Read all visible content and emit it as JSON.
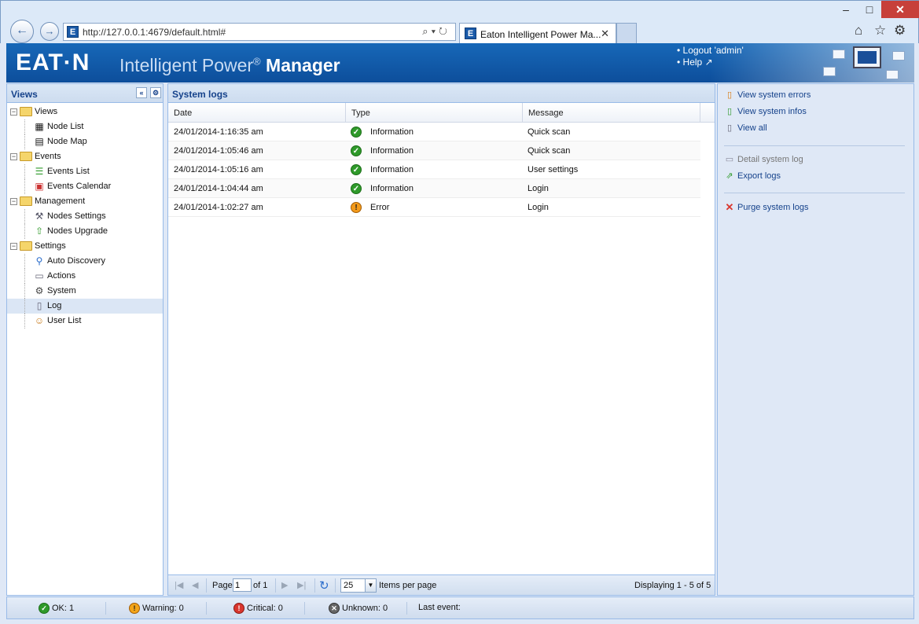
{
  "browser": {
    "url": "http://127.0.0.1:4679/default.html#",
    "tab_title": "Eaton Intelligent Power Ma...",
    "favicon_letter": "E"
  },
  "header": {
    "logo": "EAT·N",
    "title_light": "Intelligent Power",
    "title_reg": "®",
    "title_bold": "Manager",
    "logout": "• Logout 'admin'",
    "help": "• Help"
  },
  "views": {
    "title": "Views",
    "tree": [
      {
        "label": "Views",
        "children": [
          {
            "label": "Node List",
            "icon": "node-list-icon"
          },
          {
            "label": "Node Map",
            "icon": "node-map-icon"
          }
        ]
      },
      {
        "label": "Events",
        "children": [
          {
            "label": "Events List",
            "icon": "events-list-icon"
          },
          {
            "label": "Events Calendar",
            "icon": "calendar-icon"
          }
        ]
      },
      {
        "label": "Management",
        "children": [
          {
            "label": "Nodes Settings",
            "icon": "nodes-settings-icon"
          },
          {
            "label": "Nodes Upgrade",
            "icon": "upgrade-icon"
          }
        ]
      },
      {
        "label": "Settings",
        "children": [
          {
            "label": "Auto Discovery",
            "icon": "discovery-icon"
          },
          {
            "label": "Actions",
            "icon": "actions-icon"
          },
          {
            "label": "System",
            "icon": "system-gear-icon"
          },
          {
            "label": "Log",
            "icon": "log-icon"
          },
          {
            "label": "User List",
            "icon": "users-icon"
          }
        ]
      }
    ]
  },
  "logs": {
    "title": "System logs",
    "columns": [
      "Date",
      "Type",
      "Message"
    ],
    "rows": [
      {
        "date": "24/01/2014-1:16:35 am",
        "type": "Information",
        "status": "ok",
        "message": "Quick scan"
      },
      {
        "date": "24/01/2014-1:05:46 am",
        "type": "Information",
        "status": "ok",
        "message": "Quick scan"
      },
      {
        "date": "24/01/2014-1:05:16 am",
        "type": "Information",
        "status": "ok",
        "message": "User settings"
      },
      {
        "date": "24/01/2014-1:04:44 am",
        "type": "Information",
        "status": "ok",
        "message": "Login"
      },
      {
        "date": "24/01/2014-1:02:27 am",
        "type": "Error",
        "status": "error",
        "message": "Login"
      }
    ]
  },
  "pager": {
    "page_label": "Page",
    "page_value": "1",
    "of_label": "of 1",
    "per_page_value": "25",
    "items_per_page": "Items per page",
    "displaying": "Displaying 1 - 5 of 5"
  },
  "actions": {
    "view_errors": "View system errors",
    "view_infos": "View system infos",
    "view_all": "View all",
    "detail_log": "Detail system log",
    "export_logs": "Export logs",
    "purge_logs": "Purge system logs"
  },
  "status": {
    "ok": "OK: 1",
    "warning": "Warning: 0",
    "critical": "Critical: 0",
    "unknown": "Unknown: 0",
    "last_event": "Last event:"
  },
  "colors": {
    "header_blue": "#1768b8",
    "panel_title": "#15428b",
    "ok_green": "#2f9a2a",
    "error_orange": "#f39a1a"
  }
}
